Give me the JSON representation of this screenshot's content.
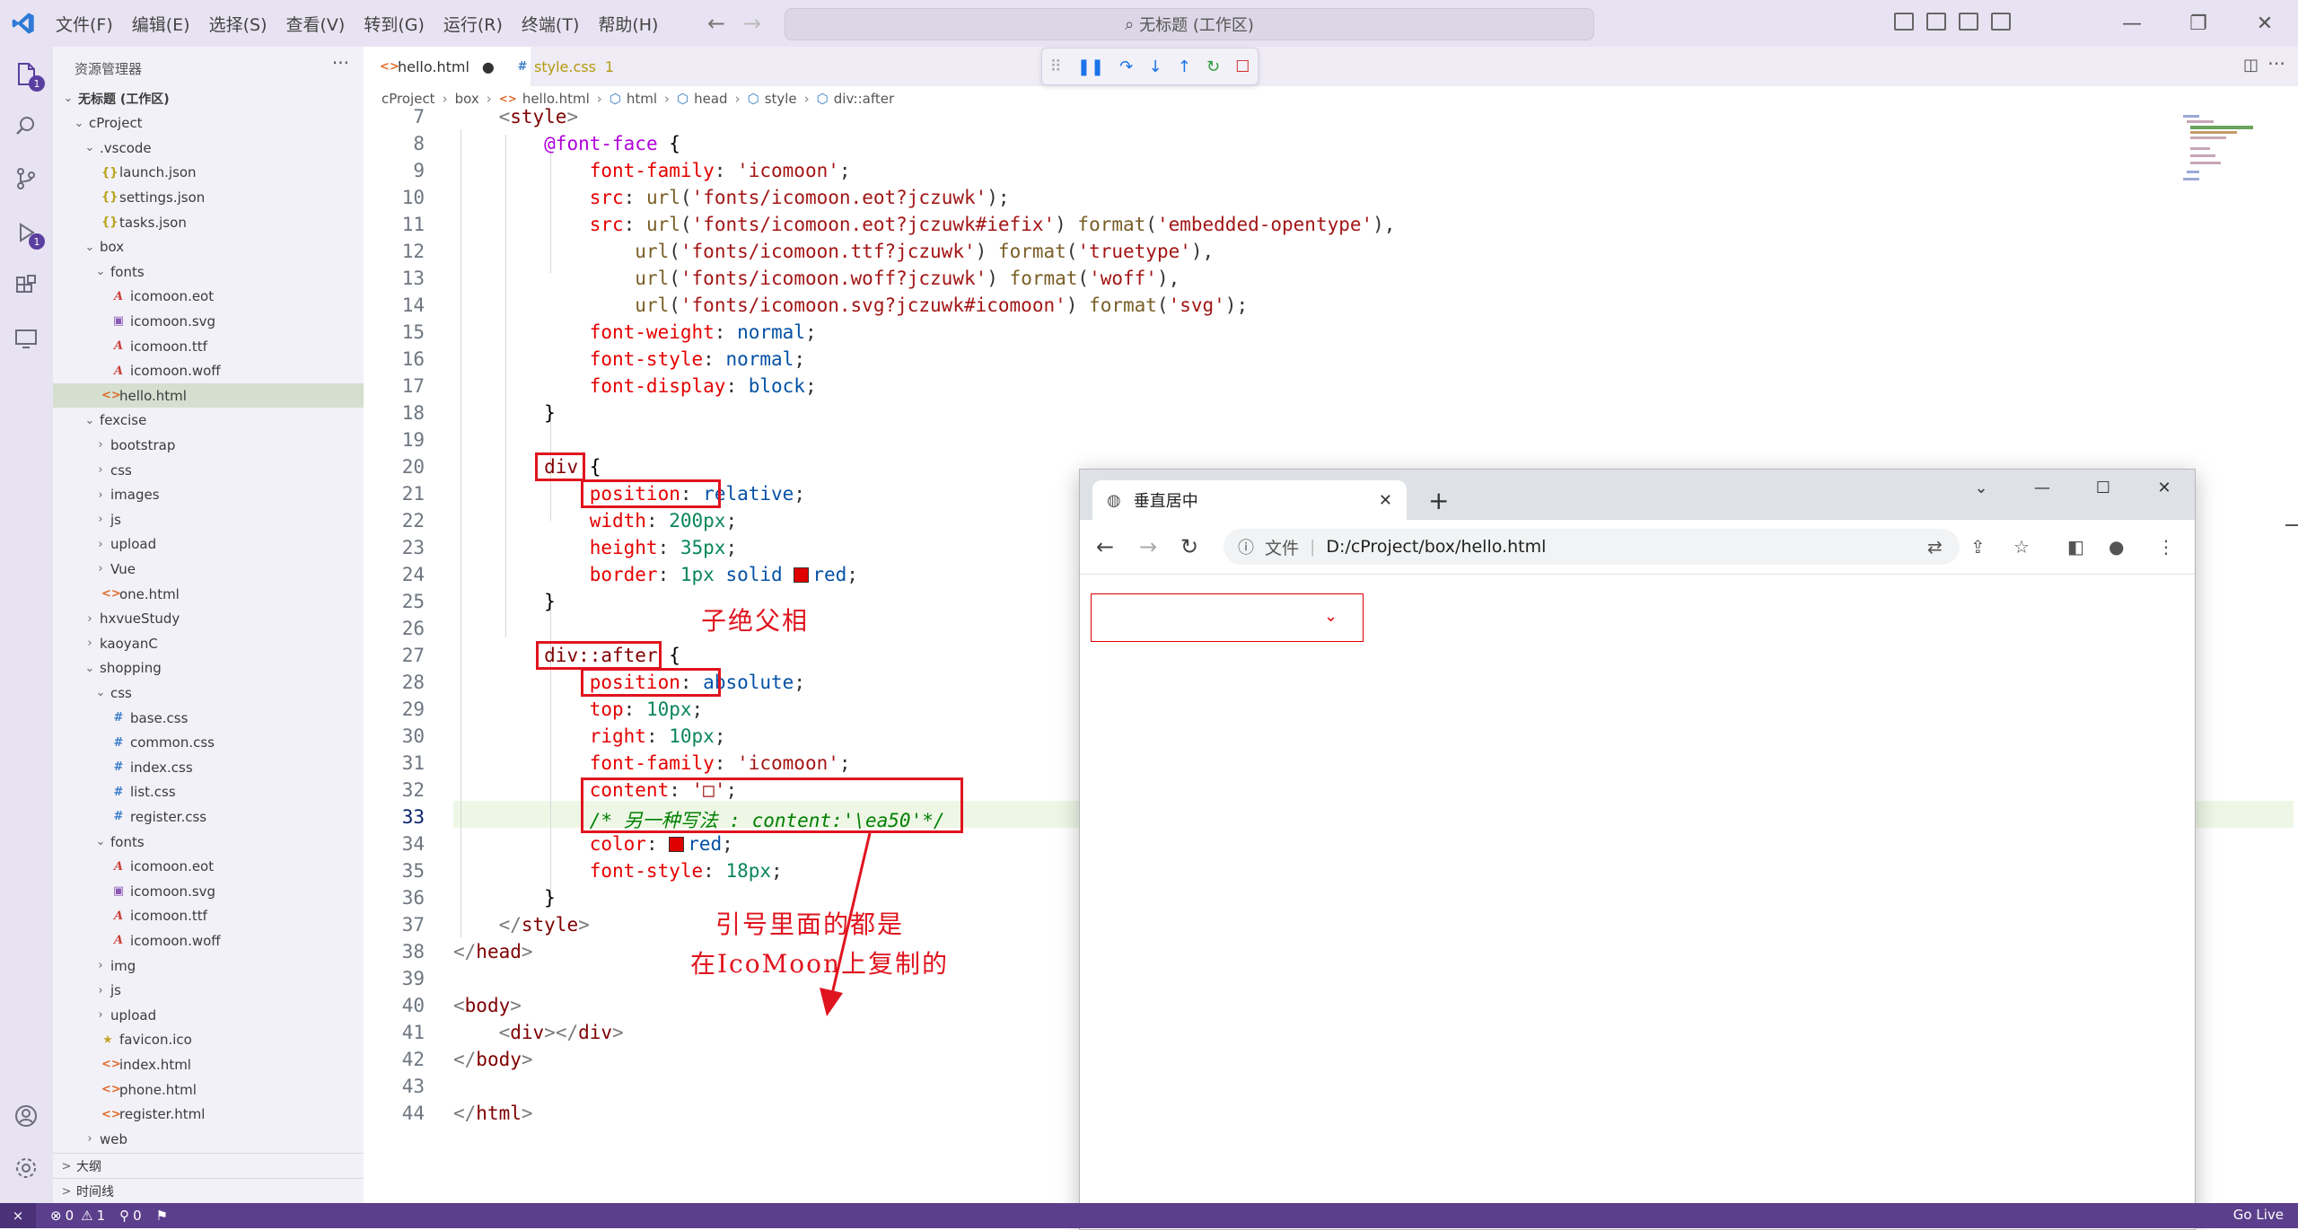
{
  "app": {
    "brand_color": "#5a3fa0",
    "accent_red": "#e0141e"
  },
  "menu": [
    "文件(F)",
    "编辑(E)",
    "选择(S)",
    "查看(V)",
    "转到(G)",
    "运行(R)",
    "终端(T)",
    "帮助(H)"
  ],
  "command_center": "无标题 (工作区)",
  "activity": {
    "explorer_badge": "1",
    "debug_badge": "1"
  },
  "sidebar": {
    "title": "资源管理器",
    "more": "···",
    "workspace": "无标题 (工作区)",
    "outline": "大纲",
    "timeline": "时间线"
  },
  "tree": [
    {
      "label": "无标题 (工作区)",
      "depth": 0,
      "chev": "v",
      "icon": ""
    },
    {
      "label": "cProject",
      "depth": 1,
      "chev": "v",
      "icon": ""
    },
    {
      "label": ".vscode",
      "depth": 2,
      "chev": "v",
      "icon": ""
    },
    {
      "label": "launch.json",
      "depth": 3,
      "chev": "",
      "icon": "json"
    },
    {
      "label": "settings.json",
      "depth": 3,
      "chev": "",
      "icon": "json"
    },
    {
      "label": "tasks.json",
      "depth": 3,
      "chev": "",
      "icon": "json"
    },
    {
      "label": "box",
      "depth": 2,
      "chev": "v",
      "icon": ""
    },
    {
      "label": "fonts",
      "depth": 3,
      "chev": "v",
      "icon": ""
    },
    {
      "label": "icomoon.eot",
      "depth": 4,
      "chev": "",
      "icon": "font"
    },
    {
      "label": "icomoon.svg",
      "depth": 4,
      "chev": "",
      "icon": "svg"
    },
    {
      "label": "icomoon.ttf",
      "depth": 4,
      "chev": "",
      "icon": "font"
    },
    {
      "label": "icomoon.woff",
      "depth": 4,
      "chev": "",
      "icon": "font"
    },
    {
      "label": "hello.html",
      "depth": 3,
      "chev": "",
      "icon": "html",
      "selected": true
    },
    {
      "label": "fexcise",
      "depth": 2,
      "chev": "v",
      "icon": ""
    },
    {
      "label": "bootstrap",
      "depth": 3,
      "chev": ">",
      "icon": ""
    },
    {
      "label": "css",
      "depth": 3,
      "chev": ">",
      "icon": ""
    },
    {
      "label": "images",
      "depth": 3,
      "chev": ">",
      "icon": ""
    },
    {
      "label": "js",
      "depth": 3,
      "chev": ">",
      "icon": ""
    },
    {
      "label": "upload",
      "depth": 3,
      "chev": ">",
      "icon": ""
    },
    {
      "label": "Vue",
      "depth": 3,
      "chev": ">",
      "icon": ""
    },
    {
      "label": "one.html",
      "depth": 3,
      "chev": "",
      "icon": "html"
    },
    {
      "label": "hxvueStudy",
      "depth": 2,
      "chev": ">",
      "icon": ""
    },
    {
      "label": "kaoyanC",
      "depth": 2,
      "chev": ">",
      "icon": ""
    },
    {
      "label": "shopping",
      "depth": 2,
      "chev": "v",
      "icon": ""
    },
    {
      "label": "css",
      "depth": 3,
      "chev": "v",
      "icon": ""
    },
    {
      "label": "base.css",
      "depth": 4,
      "chev": "",
      "icon": "css"
    },
    {
      "label": "common.css",
      "depth": 4,
      "chev": "",
      "icon": "css"
    },
    {
      "label": "index.css",
      "depth": 4,
      "chev": "",
      "icon": "css"
    },
    {
      "label": "list.css",
      "depth": 4,
      "chev": "",
      "icon": "css"
    },
    {
      "label": "register.css",
      "depth": 4,
      "chev": "",
      "icon": "css"
    },
    {
      "label": "fonts",
      "depth": 3,
      "chev": "v",
      "icon": ""
    },
    {
      "label": "icomoon.eot",
      "depth": 4,
      "chev": "",
      "icon": "font"
    },
    {
      "label": "icomoon.svg",
      "depth": 4,
      "chev": "",
      "icon": "svg"
    },
    {
      "label": "icomoon.ttf",
      "depth": 4,
      "chev": "",
      "icon": "font"
    },
    {
      "label": "icomoon.woff",
      "depth": 4,
      "chev": "",
      "icon": "font"
    },
    {
      "label": "img",
      "depth": 3,
      "chev": ">",
      "icon": ""
    },
    {
      "label": "js",
      "depth": 3,
      "chev": ">",
      "icon": ""
    },
    {
      "label": "upload",
      "depth": 3,
      "chev": ">",
      "icon": ""
    },
    {
      "label": "favicon.ico",
      "depth": 3,
      "chev": "",
      "icon": "ico"
    },
    {
      "label": "index.html",
      "depth": 3,
      "chev": "",
      "icon": "html"
    },
    {
      "label": "phone.html",
      "depth": 3,
      "chev": "",
      "icon": "html"
    },
    {
      "label": "register.html",
      "depth": 3,
      "chev": "",
      "icon": "html"
    },
    {
      "label": "web",
      "depth": 2,
      "chev": ">",
      "icon": ""
    }
  ],
  "tabs": [
    {
      "label": "hello.html",
      "modified": "●"
    },
    {
      "label": "style.css",
      "badge": "1"
    }
  ],
  "breadcrumb": [
    "cProject",
    "box",
    "hello.html",
    "html",
    "head",
    "style",
    "div::after"
  ],
  "annotations": {
    "note1": "子绝父相",
    "note2_line1": "引号里面的都是",
    "note2_line2": "在IcoMoon上复制的"
  },
  "browser": {
    "tab_title": "垂直居中",
    "scheme_label": "文件",
    "url": "D:/cProject/box/hello.html"
  },
  "status": {
    "errors": "0",
    "warnings": "1",
    "ports": "0",
    "golive": "Go Live"
  }
}
